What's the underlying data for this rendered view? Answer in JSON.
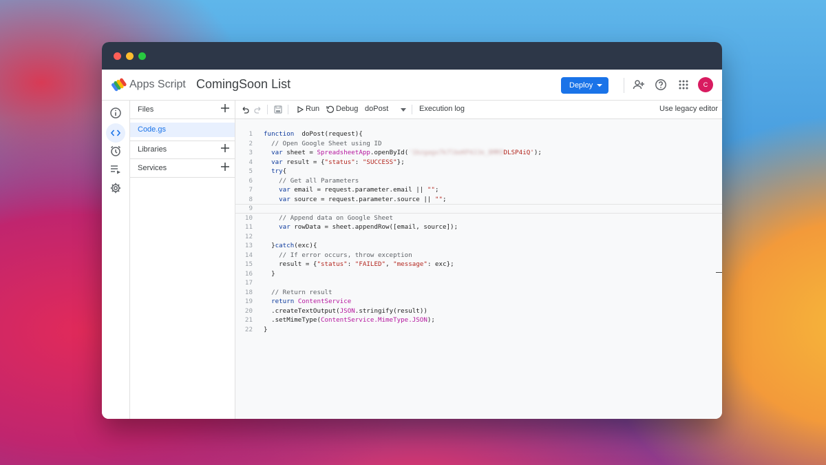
{
  "app": {
    "name": "Apps Script",
    "project_title": "ComingSoon List",
    "deploy_label": "Deploy",
    "avatar_initial": "C",
    "brand_color": "#1a73e8",
    "avatar_color": "#d81b60"
  },
  "header_icons": [
    "add-collaborator-icon",
    "help-icon",
    "apps-grid-icon"
  ],
  "rail_items": [
    "overview-icon",
    "editor-icon",
    "triggers-icon",
    "executions-icon",
    "settings-icon"
  ],
  "files_panel": {
    "files_label": "Files",
    "files": [
      {
        "name": "Code.gs",
        "selected": true
      }
    ],
    "libraries_label": "Libraries",
    "services_label": "Services"
  },
  "toolbar": {
    "run_label": "Run",
    "debug_label": "Debug",
    "function_name": "doPost",
    "execution_log_label": "Execution log",
    "legacy_editor_label": "Use legacy editor"
  },
  "code": {
    "active_line": 9,
    "lines": [
      {
        "n": "1",
        "segs": [
          [
            "kw",
            "function"
          ],
          [
            "",
            "  doPost(request){"
          ]
        ]
      },
      {
        "n": "2",
        "segs": [
          [
            "cm",
            "  // Open Google Sheet using ID"
          ]
        ]
      },
      {
        "n": "3",
        "segs": [
          [
            "kw",
            "  var"
          ],
          [
            "",
            " sheet = "
          ],
          [
            "cls",
            "SpreadsheetApp"
          ],
          [
            "",
            ".openById("
          ],
          [
            "blur",
            "'1bzgagx7k7lbeKP4JJe_8MM3"
          ],
          [
            "st",
            "DLSP4iQ'"
          ],
          [
            "",
            ");"
          ]
        ]
      },
      {
        "n": "4",
        "segs": [
          [
            "kw",
            "  var"
          ],
          [
            "",
            " result = {"
          ],
          [
            "st",
            "\"status\""
          ],
          [
            "",
            ": "
          ],
          [
            "st",
            "\"SUCCESS\""
          ],
          [
            "",
            "};"
          ]
        ]
      },
      {
        "n": "5",
        "segs": [
          [
            "kw",
            "  try"
          ],
          [
            "",
            "{"
          ]
        ]
      },
      {
        "n": "6",
        "segs": [
          [
            "cm",
            "    // Get all Parameters"
          ]
        ]
      },
      {
        "n": "7",
        "segs": [
          [
            "kw",
            "    var"
          ],
          [
            "",
            " email = request.parameter.email || "
          ],
          [
            "st",
            "\"\""
          ],
          [
            "",
            ";"
          ]
        ]
      },
      {
        "n": "8",
        "segs": [
          [
            "kw",
            "    var"
          ],
          [
            "",
            " source = request.parameter.source || "
          ],
          [
            "st",
            "\"\""
          ],
          [
            "",
            ";"
          ]
        ]
      },
      {
        "n": "9",
        "segs": [
          [
            "",
            ""
          ]
        ]
      },
      {
        "n": "10",
        "segs": [
          [
            "cm",
            "    // Append data on Google Sheet"
          ]
        ]
      },
      {
        "n": "11",
        "segs": [
          [
            "kw",
            "    var"
          ],
          [
            "",
            " rowData = sheet.appendRow([email, source]);"
          ]
        ]
      },
      {
        "n": "12",
        "segs": [
          [
            "",
            ""
          ]
        ]
      },
      {
        "n": "13",
        "segs": [
          [
            "",
            "  }"
          ],
          [
            "kw",
            "catch"
          ],
          [
            "",
            "(exc){"
          ]
        ]
      },
      {
        "n": "14",
        "segs": [
          [
            "cm",
            "    // If error occurs, throw exception"
          ]
        ]
      },
      {
        "n": "15",
        "segs": [
          [
            "",
            "    result = {"
          ],
          [
            "st",
            "\"status\""
          ],
          [
            "",
            ": "
          ],
          [
            "st",
            "\"FAILED\""
          ],
          [
            "",
            ", "
          ],
          [
            "st",
            "\"message\""
          ],
          [
            "",
            ": exc};"
          ]
        ]
      },
      {
        "n": "16",
        "segs": [
          [
            "",
            "  }"
          ]
        ]
      },
      {
        "n": "17",
        "segs": [
          [
            "",
            ""
          ]
        ]
      },
      {
        "n": "18",
        "segs": [
          [
            "cm",
            "  // Return result"
          ]
        ]
      },
      {
        "n": "19",
        "segs": [
          [
            "kw",
            "  return"
          ],
          [
            "",
            " "
          ],
          [
            "cls",
            "ContentService"
          ]
        ]
      },
      {
        "n": "20",
        "segs": [
          [
            "",
            "  .createTextOutput("
          ],
          [
            "cls",
            "JSON"
          ],
          [
            "",
            ".stringify(result))"
          ]
        ]
      },
      {
        "n": "21",
        "segs": [
          [
            "",
            "  .setMimeType("
          ],
          [
            "cls",
            "ContentService.MimeType.JSON"
          ],
          [
            "",
            ");"
          ]
        ]
      },
      {
        "n": "22",
        "segs": [
          [
            "",
            "}"
          ]
        ]
      }
    ]
  }
}
